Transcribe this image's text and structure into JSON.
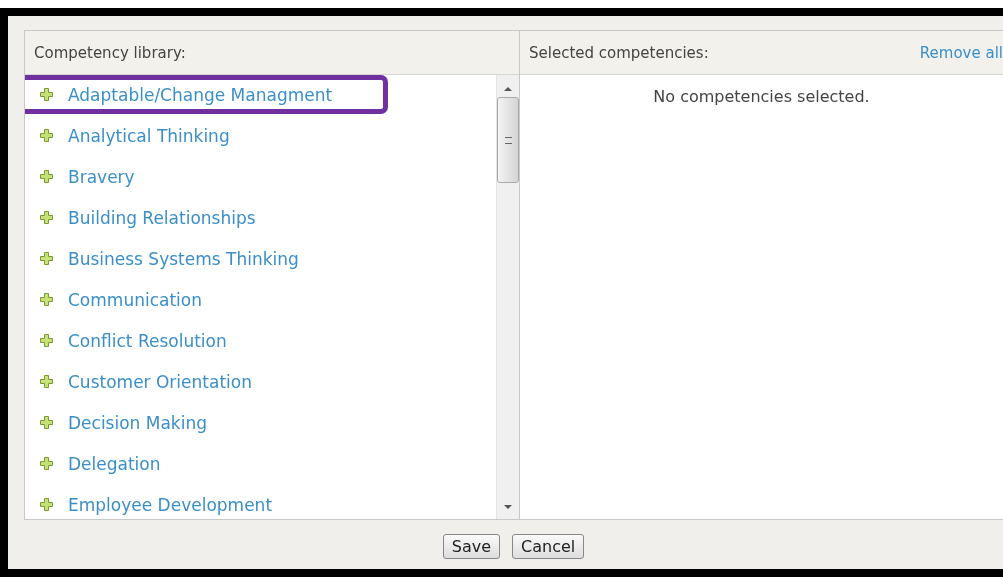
{
  "library": {
    "title": "Competency library:",
    "items": [
      {
        "label": "Adaptable/Change Managment",
        "highlighted": true
      },
      {
        "label": "Analytical Thinking",
        "highlighted": false
      },
      {
        "label": "Bravery",
        "highlighted": false
      },
      {
        "label": "Building Relationships",
        "highlighted": false
      },
      {
        "label": "Business Systems Thinking",
        "highlighted": false
      },
      {
        "label": "Communication",
        "highlighted": false
      },
      {
        "label": "Conflict Resolution",
        "highlighted": false
      },
      {
        "label": "Customer Orientation",
        "highlighted": false
      },
      {
        "label": "Decision Making",
        "highlighted": false
      },
      {
        "label": "Delegation",
        "highlighted": false
      },
      {
        "label": "Employee Development",
        "highlighted": false
      }
    ]
  },
  "selected": {
    "title": "Selected competencies:",
    "remove_all": "Remove all",
    "empty_message": "No competencies selected."
  },
  "buttons": [
    "Save",
    "Cancel"
  ]
}
